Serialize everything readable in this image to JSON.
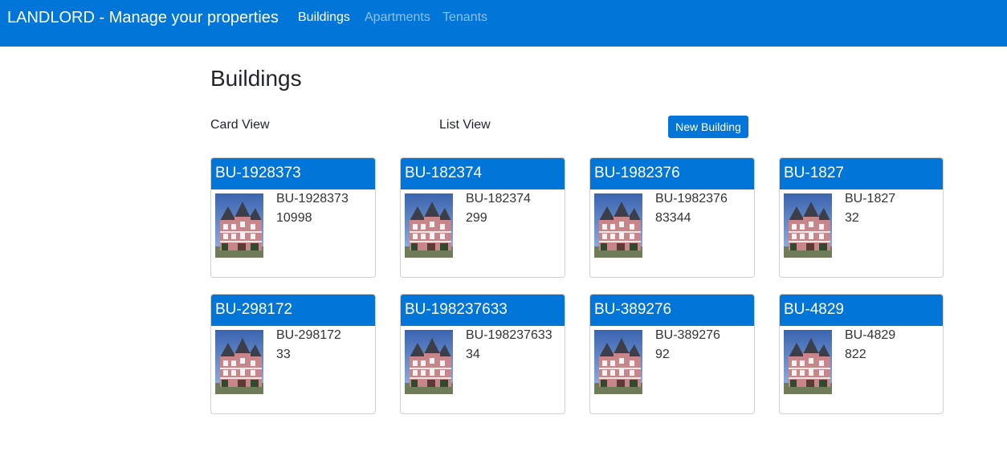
{
  "navbar": {
    "brand": "LANDLORD - Manage your properties",
    "items": [
      {
        "label": "Buildings",
        "active": true
      },
      {
        "label": "Apartments",
        "active": false
      },
      {
        "label": "Tenants",
        "active": false
      }
    ],
    "color": "#0275d8"
  },
  "page": {
    "title": "Buildings",
    "card_view_label": "Card View",
    "list_view_label": "List View",
    "new_button_label": "New Building"
  },
  "buildings": [
    {
      "header": "BU-1928373",
      "code": "BU-1928373",
      "value": "10998"
    },
    {
      "header": "BU-182374",
      "code": "BU-182374",
      "value": "299"
    },
    {
      "header": "BU-1982376",
      "code": "BU-1982376",
      "value": "83344"
    },
    {
      "header": "BU-1827",
      "code": "BU-1827",
      "value": "32"
    },
    {
      "header": "BU-298172",
      "code": "BU-298172",
      "value": "33"
    },
    {
      "header": "BU-198237633",
      "code": "BU-198237633",
      "value": "34"
    },
    {
      "header": "BU-389276",
      "code": "BU-389276",
      "value": "92"
    },
    {
      "header": "BU-4829",
      "code": "BU-4829",
      "value": "822"
    }
  ]
}
